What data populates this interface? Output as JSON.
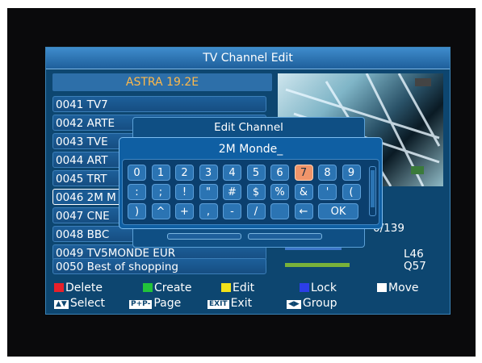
{
  "window": {
    "title": "TV Channel Edit"
  },
  "satellite": "ASTRA 19.2E",
  "channels": [
    {
      "label": "0041 TV7"
    },
    {
      "label": "0042 ARTE"
    },
    {
      "label": "0043 TVE"
    },
    {
      "label": "0044 ART"
    },
    {
      "label": "0045 TRT"
    },
    {
      "label": "0046 2M M"
    },
    {
      "label": "0047 CNE"
    },
    {
      "label": "0048 BBC"
    },
    {
      "label": "0049 TV5MONDE EUR"
    },
    {
      "label": "0050 Best of shopping"
    }
  ],
  "selected_index": 5,
  "info": {
    "count": "0/139",
    "level": "L46",
    "quality": "Q57"
  },
  "edit_dialog": {
    "title": "Edit Channel",
    "input_value": "2M Monde_",
    "keys_row1": [
      "0",
      "1",
      "2",
      "3",
      "4",
      "5",
      "6",
      "7",
      "8",
      "9"
    ],
    "keys_row2": [
      ":",
      ";",
      "!",
      "\"",
      "#",
      "$",
      "%",
      "&",
      "'",
      "("
    ],
    "keys_row3": [
      ")",
      "^",
      "+",
      ",",
      "-",
      "/",
      "",
      "←",
      "OK"
    ],
    "active_key": "7"
  },
  "legend": {
    "delete": "Delete",
    "create": "Create",
    "edit": "Edit",
    "lock": "Lock",
    "move": "Move",
    "select": "Select",
    "page": "Page",
    "exit": "Exit",
    "group": "Group",
    "page_key": "P+P-",
    "exit_key": "EXIT"
  },
  "colors": {
    "red": "#e8202a",
    "green": "#22c43a",
    "yellow": "#f2e21a",
    "blue": "#2c3ee8",
    "white": "#ffffff",
    "accent": "#f0956a",
    "satellite_text": "#ffb94a"
  }
}
